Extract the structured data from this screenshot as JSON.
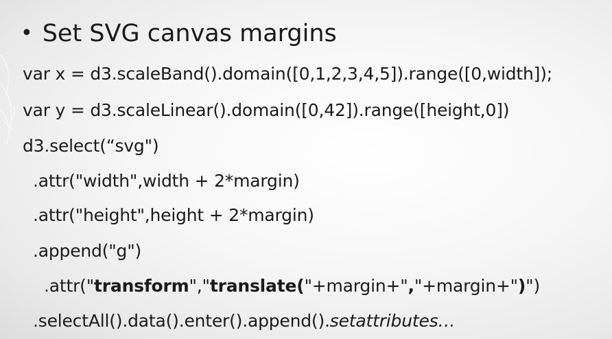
{
  "slide": {
    "bullet": "•",
    "title": "Set SVG canvas margins",
    "lines": {
      "l1": "var x = d3.scaleBand().domain([0,1,2,3,4,5]).range([0,width]);",
      "l2": "var y = d3.scaleLinear().domain([0,42]).range([height,0])",
      "l3": "d3.select(“svg\")",
      "l4": ".attr(\"width\",width + 2*margin)",
      "l5": ".attr(\"height\",height + 2*margin)",
      "l6": ".append(\"g\")",
      "l7": {
        "p1": ".attr(\"",
        "p2": "transform",
        "p3": "\",\"",
        "p4": "translate(",
        "p5": "\"+margin+\"",
        "p6": ",",
        "p7": "\"+margin+\"",
        "p8": ")",
        "p9": "\")"
      },
      "l8": {
        "p1": ".selectAll().data().enter().append().",
        "p2": "setattributes…"
      }
    }
  }
}
